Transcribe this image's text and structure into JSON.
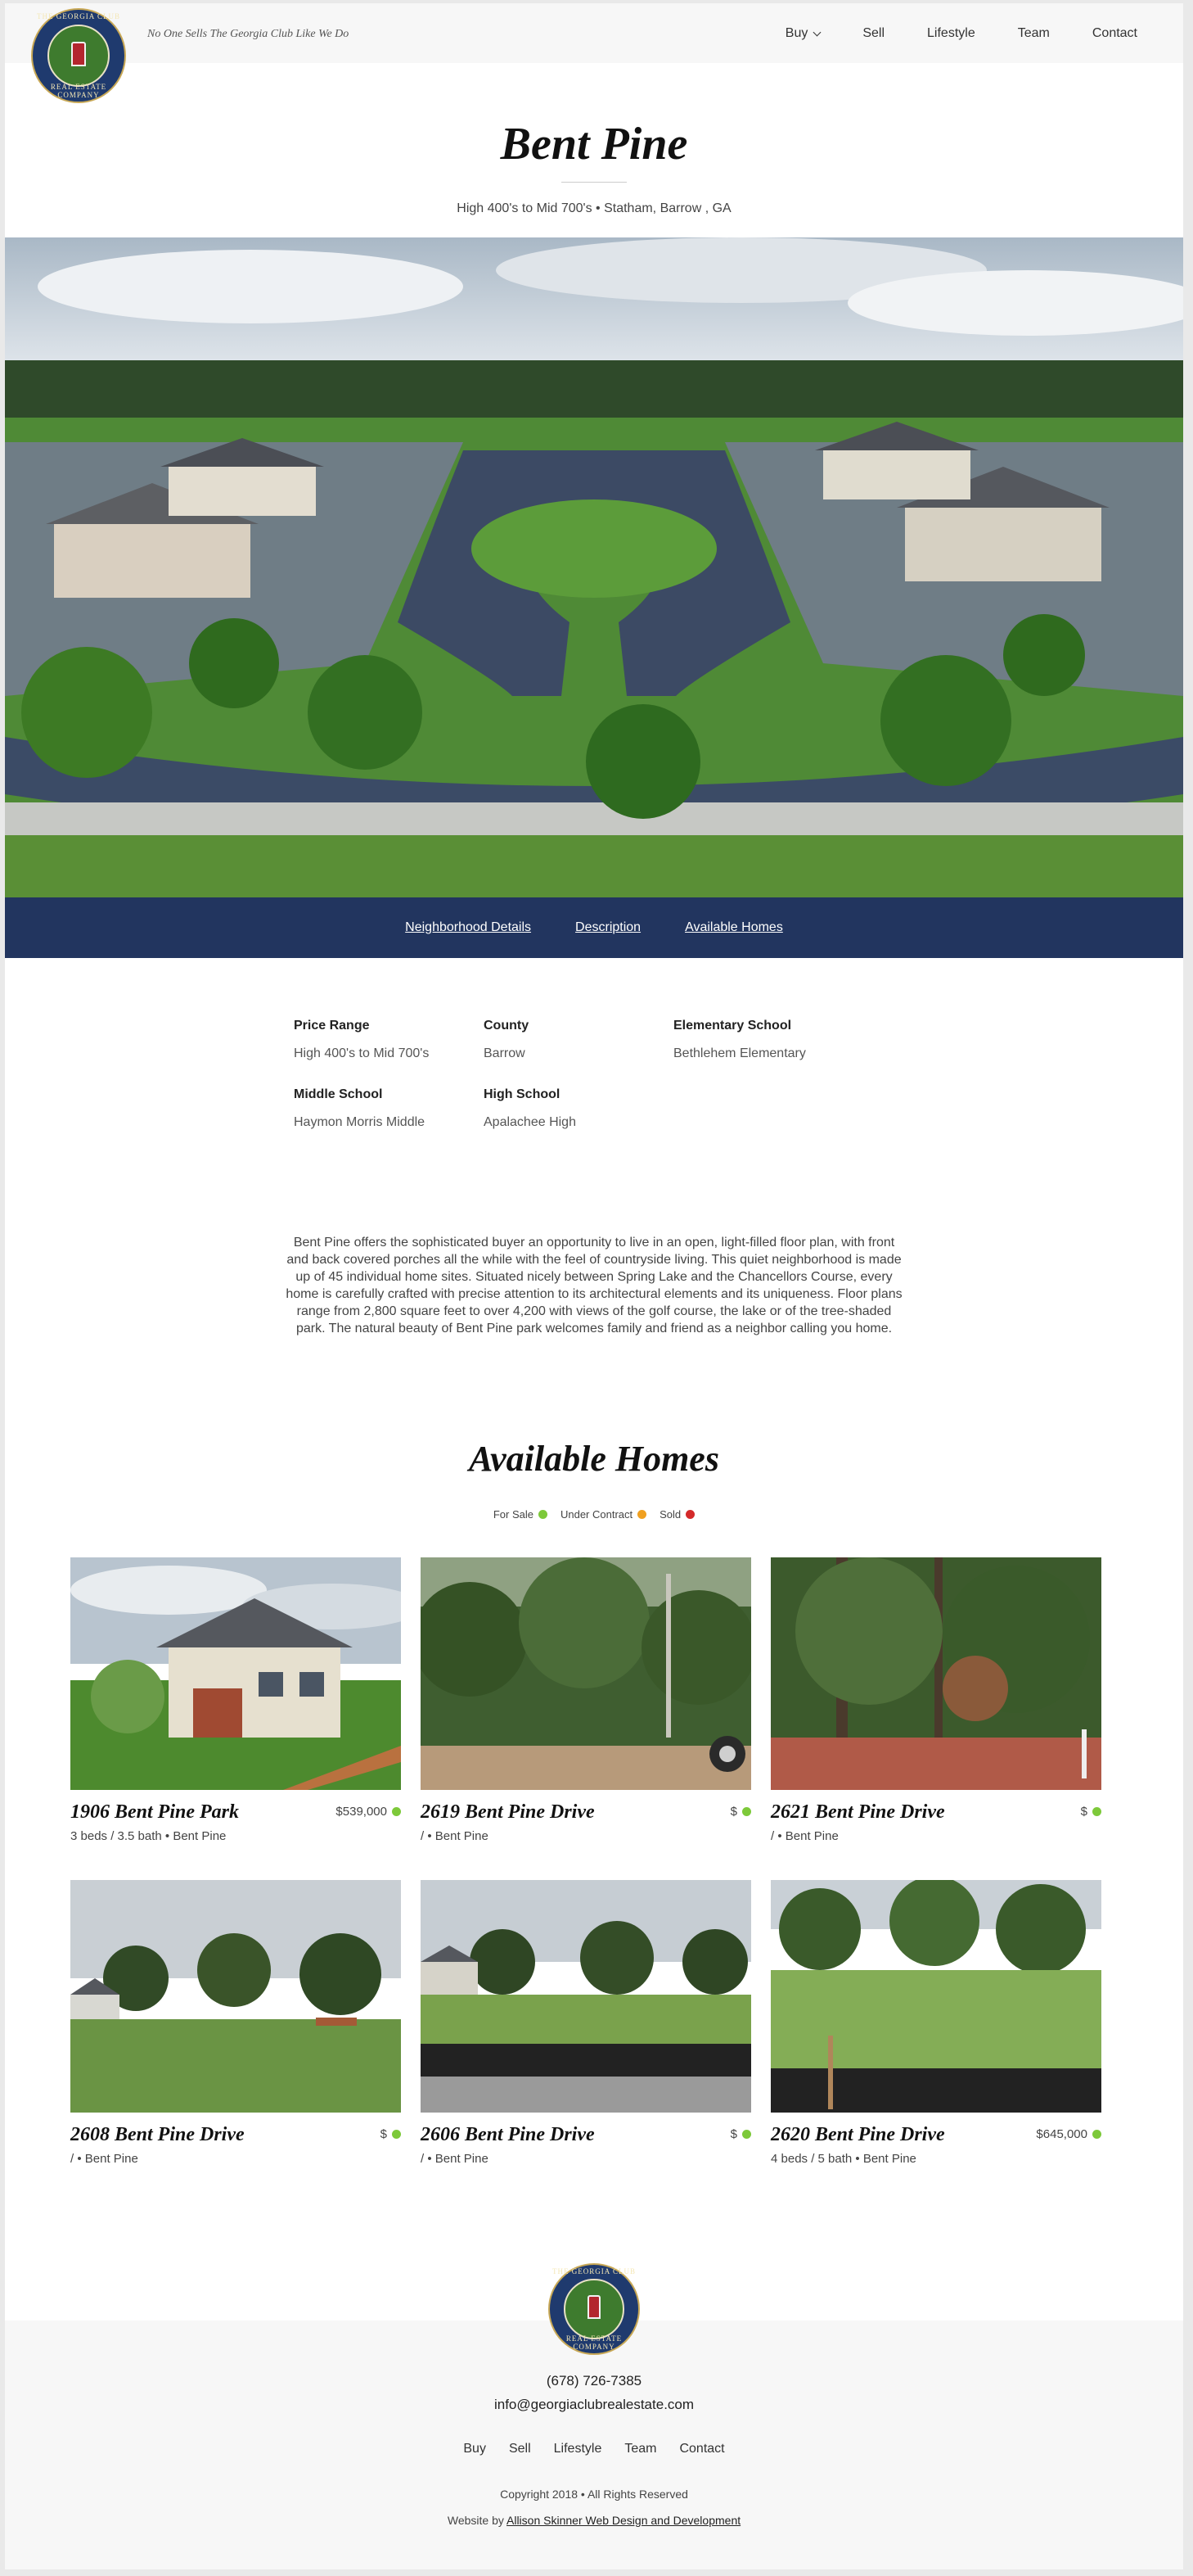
{
  "brand": {
    "logo_text_top": "THE GEORGIA CLUB",
    "logo_text_bottom": "REAL ESTATE COMPANY",
    "tagline": "No One Sells The Georgia Club Like We Do"
  },
  "nav": {
    "items": [
      {
        "label": "Buy",
        "has_dropdown": true
      },
      {
        "label": "Sell"
      },
      {
        "label": "Lifestyle"
      },
      {
        "label": "Team"
      },
      {
        "label": "Contact"
      }
    ]
  },
  "page": {
    "title": "Bent Pine",
    "subtitle": "High 400's to Mid 700's • Statham, Barrow , GA"
  },
  "section_nav": {
    "items": [
      "Neighborhood Details",
      "Description",
      "Available Homes"
    ]
  },
  "details": [
    {
      "label": "Price Range",
      "value": "High 400's to Mid 700's"
    },
    {
      "label": "County",
      "value": "Barrow"
    },
    {
      "label": "Elementary School",
      "value": "Bethlehem Elementary"
    },
    {
      "label": "Middle School",
      "value": "Haymon Morris Middle"
    },
    {
      "label": "High School",
      "value": "Apalachee High"
    }
  ],
  "description": "Bent Pine offers the sophisticated buyer an opportunity to live in an open, light-filled floor plan, with front and back covered porches all the while with the feel of countryside living.  This quiet neighborhood is  made up of 45 individual home sites.  Situated nicely between Spring Lake and the Chancellors Course,  every home is carefully crafted with precise attention to its architectural elements and its uniqueness.   Floor plans range from 2,800 square feet to over 4,200  with views of the golf course, the lake or of the tree-shaded park. The natural beauty of Bent Pine park welcomes family and friend as a neighbor calling you home.",
  "available": {
    "title": "Available Homes",
    "legend": [
      {
        "label": "For Sale",
        "color": "#7dc93a"
      },
      {
        "label": "Under Contract",
        "color": "#f0a020"
      },
      {
        "label": "Sold",
        "color": "#d42a2a"
      }
    ],
    "homes": [
      {
        "name": "1906 Bent Pine Park",
        "price": "$539,000",
        "meta": "3 beds / 3.5 bath • Bent Pine",
        "status_color": "#7dc93a",
        "photo": "house"
      },
      {
        "name": "2619 Bent Pine Drive",
        "price": "$",
        "meta": "/ • Bent Pine",
        "status_color": "#7dc93a",
        "photo": "woods"
      },
      {
        "name": "2621 Bent Pine Drive",
        "price": "$",
        "meta": "/ • Bent Pine",
        "status_color": "#7dc93a",
        "photo": "clearing"
      },
      {
        "name": "2608 Bent Pine Drive",
        "price": "$",
        "meta": "/ • Bent Pine",
        "status_color": "#7dc93a",
        "photo": "lot"
      },
      {
        "name": "2606 Bent Pine Drive",
        "price": "$",
        "meta": "/ • Bent Pine",
        "status_color": "#7dc93a",
        "photo": "lot2"
      },
      {
        "name": "2620 Bent Pine Drive",
        "price": "$645,000",
        "meta": "4 beds / 5 bath • Bent Pine",
        "status_color": "#7dc93a",
        "photo": "lot3"
      }
    ]
  },
  "footer": {
    "phone": "(678) 726-7385",
    "email": "info@georgiaclubrealestate.com",
    "nav": [
      "Buy",
      "Sell",
      "Lifestyle",
      "Team",
      "Contact"
    ],
    "copyright": "Copyright 2018 • All Rights Reserved",
    "credit_prefix": "Website by",
    "credit_link": "Allison Skinner Web Design and Development"
  }
}
